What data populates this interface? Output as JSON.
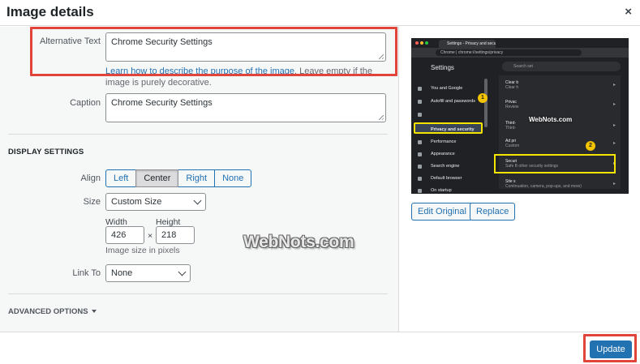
{
  "header": {
    "title": "Image details",
    "close_glyph": "×"
  },
  "form": {
    "alt_label": "Alternative Text",
    "alt_value": "Chrome Security Settings",
    "alt_help_link": "Learn how to describe the purpose of the image",
    "alt_help_text": ". Leave empty if the image is purely decorative.",
    "caption_label": "Caption",
    "caption_value": "Chrome Security Settings"
  },
  "display": {
    "section_title": "DISPLAY SETTINGS",
    "align_label": "Align",
    "align_options": [
      "Left",
      "Center",
      "Right",
      "None"
    ],
    "align_selected": "Center",
    "size_label": "Size",
    "size_value": "Custom Size",
    "width_label": "Width",
    "height_label": "Height",
    "width_value": "426",
    "height_value": "218",
    "times_glyph": "×",
    "size_help": "Image size in pixels",
    "linkto_label": "Link To",
    "linkto_value": "None"
  },
  "advanced": {
    "label": "ADVANCED OPTIONS"
  },
  "watermark": "WebNots.com",
  "preview": {
    "tab_title": "Settings - Privacy and securi",
    "url": "Chrome | chrome://settings/privacy",
    "settings_title": "Settings",
    "search_placeholder": "Search set",
    "menu": [
      "You and Google",
      "Autofill and passwords",
      "Privacy and security",
      "Performance",
      "Appearance",
      "Search engine",
      "Default browser",
      "On startup",
      "Languages"
    ],
    "rows": [
      {
        "title": "Clear b",
        "sub": "Clear h"
      },
      {
        "title": "Privac",
        "sub": "Review"
      },
      {
        "title": "Third-",
        "sub": "Third-"
      },
      {
        "title": "Ad pri",
        "sub": "Custom"
      },
      {
        "title": "Securi",
        "sub": "Safe B  other security settings"
      },
      {
        "title": "Site s",
        "sub": "Continuation, camera, pop-ups, and more)"
      }
    ],
    "badge1": "1",
    "badge2": "2",
    "watermark": "WebNots.com"
  },
  "actions": {
    "edit_original": "Edit Original",
    "replace": "Replace",
    "update": "Update"
  },
  "colors": {
    "accent": "#2271b1",
    "highlight_red": "#e0443a",
    "highlight_yellow": "#f5e400"
  }
}
